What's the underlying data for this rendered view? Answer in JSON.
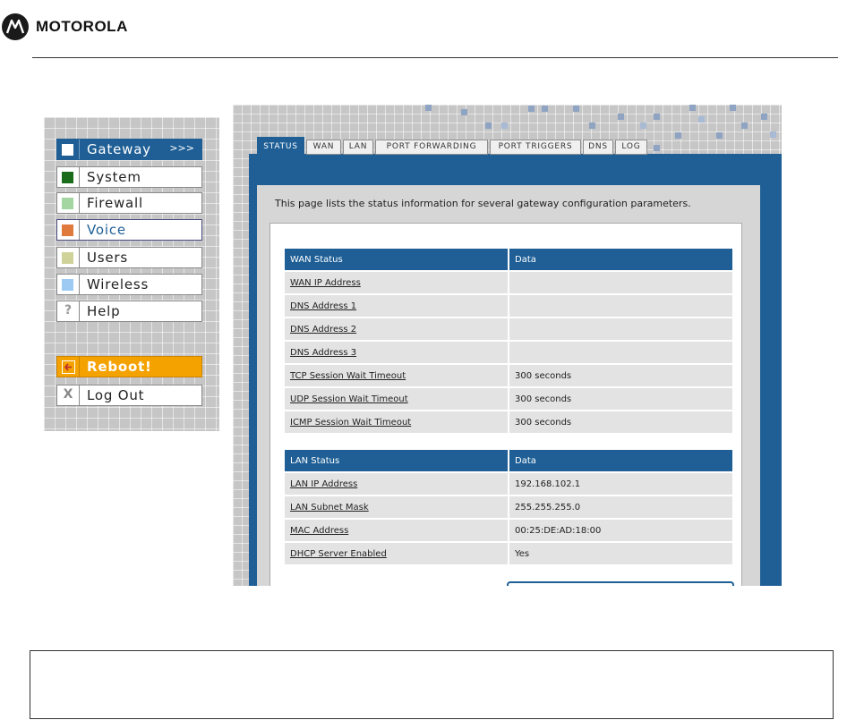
{
  "header": {
    "brand": "MOTOROLA"
  },
  "menu": {
    "items": [
      {
        "label": "Gateway",
        "swatch": "#ffffff",
        "active": true,
        "indicator": ">>>"
      },
      {
        "label": "System",
        "swatch": "#1a6b1a"
      },
      {
        "label": "Firewall",
        "swatch": "#a3d6a0"
      },
      {
        "label": "Voice",
        "swatch": "#e07a3c"
      },
      {
        "label": "Users",
        "swatch": "#cfd39a"
      },
      {
        "label": "Wireless",
        "swatch": "#9ccaf2"
      },
      {
        "label": "Help",
        "glyph": "?"
      },
      {
        "label": "Reboot!",
        "icon": "back-arrow-icon"
      },
      {
        "label": "Log Out",
        "glyph": "X"
      }
    ]
  },
  "tabs": [
    "STATUS",
    "WAN",
    "LAN",
    "PORT FORWARDING",
    "PORT TRIGGERS",
    "DNS",
    "LOG"
  ],
  "active_tab": "STATUS",
  "intro_text": "This page lists the status information for several gateway configuration parameters.",
  "wan_table": {
    "headers": [
      "WAN Status",
      "Data"
    ],
    "rows": [
      [
        "WAN IP Address",
        ""
      ],
      [
        "DNS Address 1",
        ""
      ],
      [
        "DNS Address 2",
        ""
      ],
      [
        "DNS Address 3",
        ""
      ],
      [
        "TCP Session Wait Timeout",
        "300 seconds"
      ],
      [
        "UDP Session Wait Timeout",
        "300 seconds"
      ],
      [
        "ICMP Session Wait Timeout",
        "300 seconds"
      ]
    ]
  },
  "lan_table": {
    "headers": [
      "LAN Status",
      "Data"
    ],
    "rows": [
      [
        "LAN IP Address",
        "192.168.102.1"
      ],
      [
        "LAN Subnet Mask",
        "255.255.255.0"
      ],
      [
        "MAC Address",
        "00:25:DE:AD:18:00"
      ],
      [
        "DHCP Server Enabled",
        "Yes"
      ]
    ]
  },
  "colors": {
    "accent": "#1f5f96",
    "reboot": "#f4a200"
  }
}
